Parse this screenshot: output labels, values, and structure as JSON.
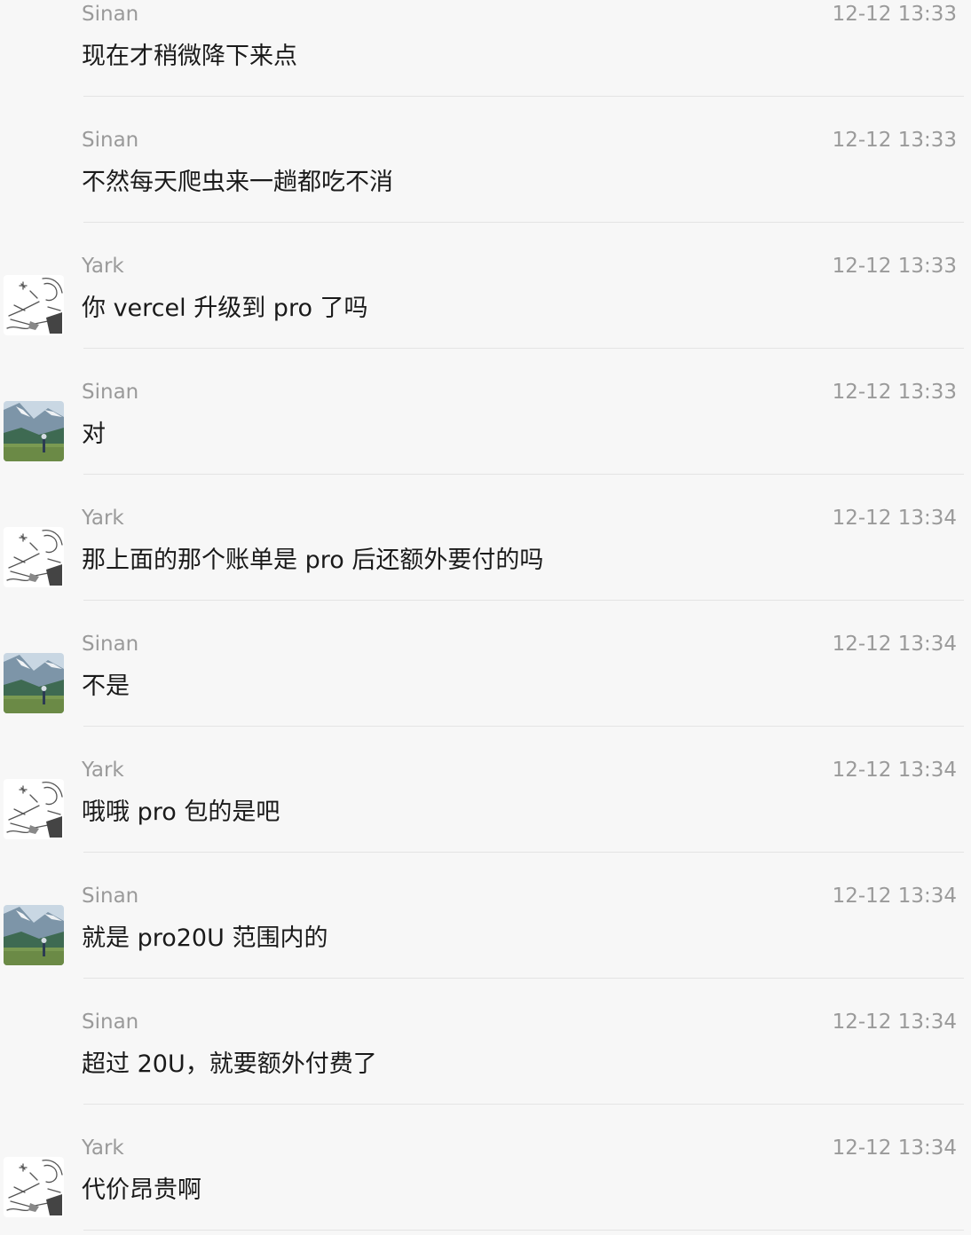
{
  "messages": [
    {
      "sender": "Sinan",
      "time": "12-12 13:33",
      "text": "现在才稍微降下来点",
      "avatar": "none"
    },
    {
      "sender": "Sinan",
      "time": "12-12 13:33",
      "text": "不然每天爬虫来一趟都吃不消",
      "avatar": "none"
    },
    {
      "sender": "Yark",
      "time": "12-12 13:33",
      "text": "你 vercel 升级到 pro 了吗",
      "avatar": "sketch"
    },
    {
      "sender": "Sinan",
      "time": "12-12 13:33",
      "text": "对",
      "avatar": "mountain"
    },
    {
      "sender": "Yark",
      "time": "12-12 13:34",
      "text": "那上面的那个账单是 pro 后还额外要付的吗",
      "avatar": "sketch"
    },
    {
      "sender": "Sinan",
      "time": "12-12 13:34",
      "text": "不是",
      "avatar": "mountain"
    },
    {
      "sender": "Yark",
      "time": "12-12 13:34",
      "text": "哦哦 pro 包的是吧",
      "avatar": "sketch"
    },
    {
      "sender": "Sinan",
      "time": "12-12 13:34",
      "text": "就是 pro20U 范围内的",
      "avatar": "mountain"
    },
    {
      "sender": "Sinan",
      "time": "12-12 13:34",
      "text": "超过 20U，就要额外付费了",
      "avatar": "none"
    },
    {
      "sender": "Yark",
      "time": "12-12 13:34",
      "text": "代价昂贵啊",
      "avatar": "sketch"
    }
  ]
}
